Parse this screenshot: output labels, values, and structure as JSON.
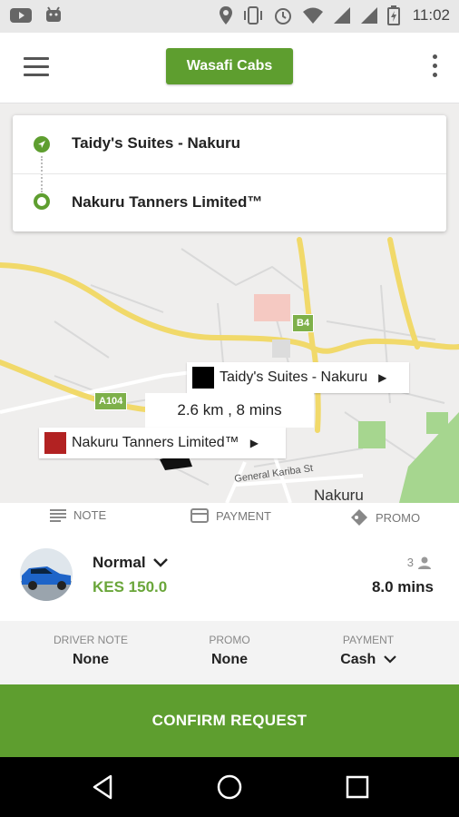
{
  "status_bar": {
    "time": "11:02",
    "icons": [
      "youtube-icon",
      "android-icon",
      "location-icon",
      "vibrate-icon",
      "alarm-icon",
      "wifi-icon",
      "signal-icon",
      "signal-icon",
      "battery-icon"
    ]
  },
  "app_bar": {
    "brand_label": "Wasafi Cabs"
  },
  "route": {
    "pickup": "Taidy's Suites - Nakuru",
    "dropoff": "Nakuru Tanners Limited™"
  },
  "map": {
    "pickup_label": "Taidy's Suites - Nakuru",
    "dropoff_label": "Nakuru Tanners Limited™",
    "distance_time": "2.6 km , 8 mins",
    "road_b4": "B4",
    "road_a104": "A104",
    "street": "General Kariba St",
    "city": "Nakuru"
  },
  "options": {
    "note": "NOTE",
    "payment": "PAYMENT",
    "promo": "PROMO"
  },
  "ride": {
    "name": "Normal",
    "price": "KES 150.0",
    "seats": "3",
    "eta": "8.0 mins"
  },
  "summary": {
    "driver_note_label": "DRIVER NOTE",
    "driver_note_value": "None",
    "promo_label": "PROMO",
    "promo_value": "None",
    "payment_label": "PAYMENT",
    "payment_value": "Cash"
  },
  "confirm_label": "CONFIRM REQUEST",
  "colors": {
    "brand": "#5e9e2f",
    "price": "#6aa63a",
    "pickup_marker": "#000000",
    "dropoff_marker": "#b22222"
  }
}
